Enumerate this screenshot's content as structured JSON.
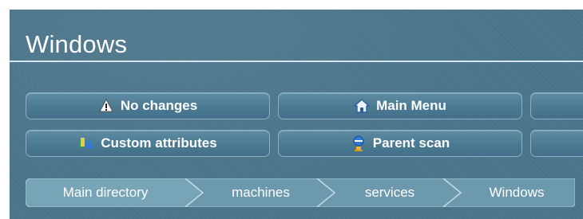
{
  "page": {
    "title": "Windows"
  },
  "buttons": {
    "row1": [
      {
        "label": "No changes",
        "icon": "warning-icon"
      },
      {
        "label": "Main Menu",
        "icon": "home-icon"
      },
      {
        "label": "",
        "icon": ""
      }
    ],
    "row2": [
      {
        "label": "Custom attributes",
        "icon": "custom-attributes-icon"
      },
      {
        "label": "Parent scan",
        "icon": "scan-person-icon"
      },
      {
        "label": "",
        "icon": ""
      }
    ]
  },
  "breadcrumb": {
    "items": [
      "Main directory",
      "machines",
      "services",
      "Windows"
    ]
  },
  "colors": {
    "panel": "#4a7489",
    "button": "#4b7a92",
    "button_border": "#8bb0c2",
    "breadcrumb": "#6c99ae",
    "text": "#ffffff"
  }
}
